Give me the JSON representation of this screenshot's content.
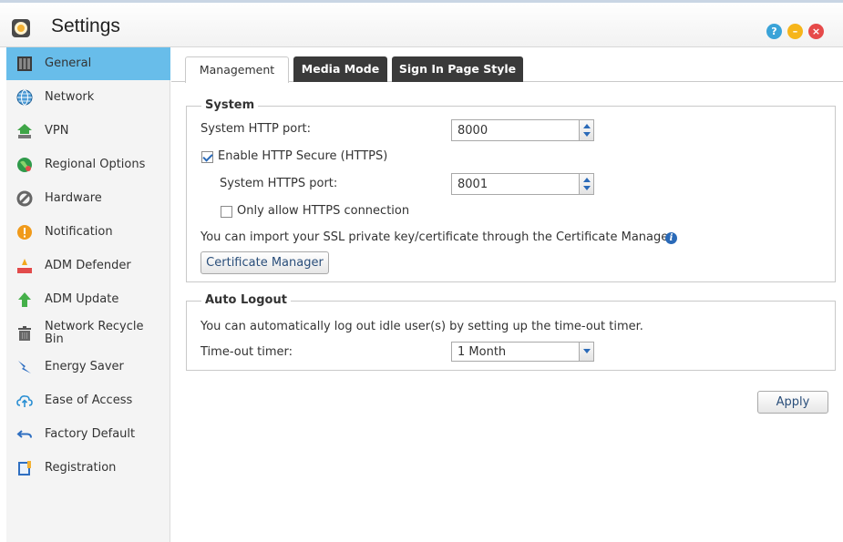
{
  "window": {
    "title": "Settings",
    "controls": {
      "help": "?",
      "minimize": "–",
      "close": "×"
    }
  },
  "sidebar": {
    "items": [
      {
        "label": "General",
        "icon": "general-icon",
        "active": true
      },
      {
        "label": "Network",
        "icon": "globe-icon"
      },
      {
        "label": "VPN",
        "icon": "vpn-icon"
      },
      {
        "label": "Regional Options",
        "icon": "regional-icon"
      },
      {
        "label": "Hardware",
        "icon": "hardware-icon"
      },
      {
        "label": "Notification",
        "icon": "notification-icon"
      },
      {
        "label": "ADM Defender",
        "icon": "defender-icon"
      },
      {
        "label": "ADM Update",
        "icon": "update-icon"
      },
      {
        "label": "Network Recycle Bin",
        "icon": "trash-icon"
      },
      {
        "label": "Energy Saver",
        "icon": "energy-icon"
      },
      {
        "label": "Ease of Access",
        "icon": "cloud-upload-icon"
      },
      {
        "label": "Factory Default",
        "icon": "undo-icon"
      },
      {
        "label": "Registration",
        "icon": "registration-icon"
      }
    ]
  },
  "tabs": [
    {
      "label": "Management",
      "active": true
    },
    {
      "label": "Media Mode"
    },
    {
      "label": "Sign In Page Style"
    }
  ],
  "system": {
    "legend": "System",
    "http_port_label": "System HTTP port:",
    "http_port_value": "8000",
    "https_enable_label": "Enable HTTP Secure (HTTPS)",
    "https_enabled": true,
    "https_port_label": "System HTTPS port:",
    "https_port_value": "8001",
    "only_https_label": "Only allow HTTPS connection",
    "only_https": false,
    "cert_info": "You can import your SSL private key/certificate through the Certificate Manager.",
    "cert_button": "Certificate Manager"
  },
  "auto_logout": {
    "legend": "Auto Logout",
    "description": "You can automatically log out idle user(s) by setting up the time-out timer.",
    "timer_label": "Time-out timer:",
    "timer_value": "1 Month"
  },
  "apply_button": "Apply",
  "colors": {
    "active_sidebar": "#68bdea",
    "dark_tab": "#3a3a3a",
    "link_blue": "#2a6ab8"
  }
}
